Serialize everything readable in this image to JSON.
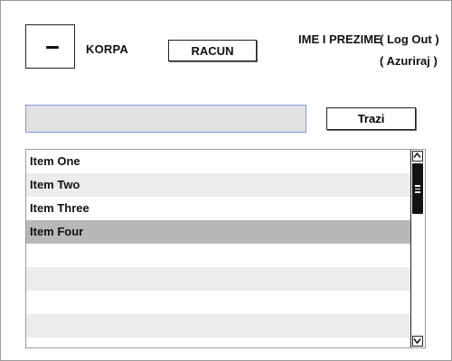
{
  "header": {
    "cart_label": "KORPA",
    "account_button": "RACUN",
    "user_name": "IME I PREZIME",
    "logout_link": "( Log Out )",
    "update_link": "( Azuriraj )"
  },
  "search": {
    "value": "",
    "placeholder": "",
    "button_label": "Trazi"
  },
  "list": {
    "items": [
      {
        "label": "Item One"
      },
      {
        "label": "Item Two"
      },
      {
        "label": "Item Three"
      },
      {
        "label": "Item Four",
        "selected": true
      },
      {
        "label": ""
      },
      {
        "label": ""
      },
      {
        "label": ""
      },
      {
        "label": ""
      },
      {
        "label": ""
      }
    ]
  },
  "icons": {
    "cart": "cart-icon",
    "scroll_up": "chevron-up-icon",
    "scroll_down": "chevron-down-icon",
    "scroll_thumb_grip": "grip-lines-icon"
  },
  "colors": {
    "search_border": "#7f9be0",
    "search_background": "#e1e1e1",
    "row_alternate": "#ececec",
    "row_selected": "#b8b8b8"
  }
}
